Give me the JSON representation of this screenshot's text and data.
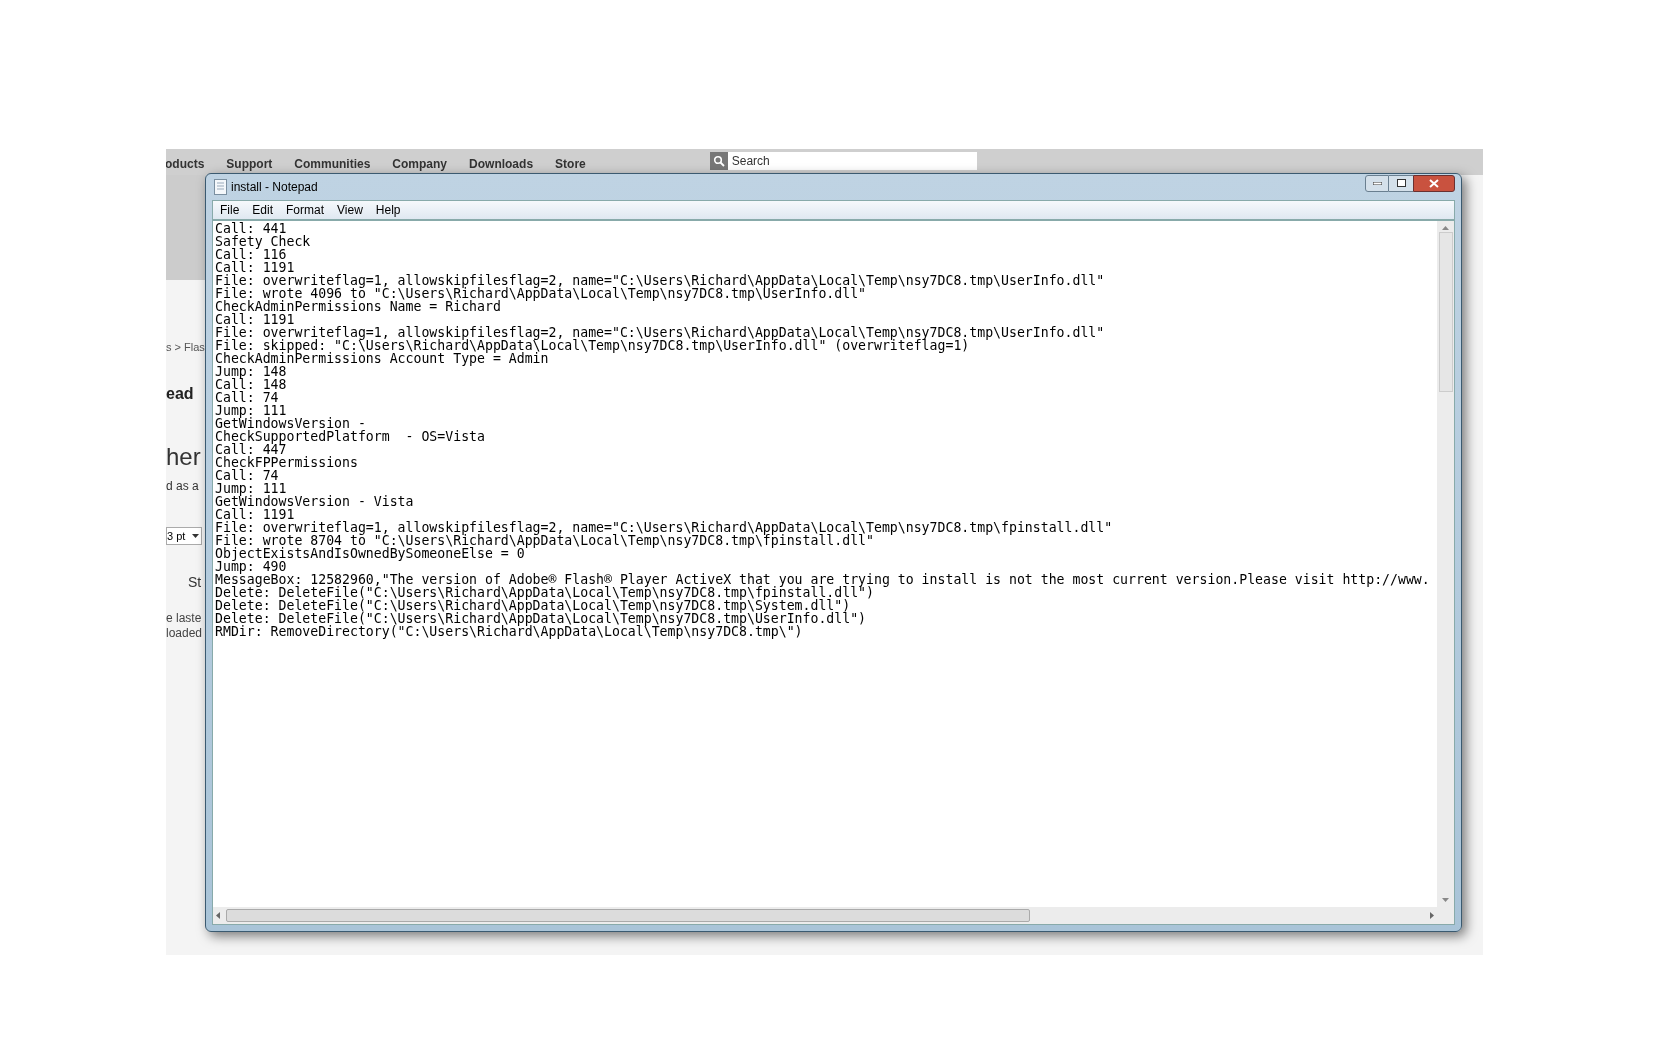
{
  "web_page": {
    "nav_items": [
      "oducts",
      "Support",
      "Communities",
      "Company",
      "Downloads",
      "Store"
    ],
    "search": {
      "placeholder": "Search"
    },
    "breadcrumb": "s > Flas",
    "heading_fragment": "ead",
    "large_heading_fragment": "her",
    "text_fragment": "d as a",
    "font_size_field": "3 pt",
    "style_fragment": "St",
    "text_lines": [
      "e laste",
      "loaded"
    ]
  },
  "notepad": {
    "title": "install - Notepad",
    "menu": [
      "File",
      "Edit",
      "Format",
      "View",
      "Help"
    ],
    "lines": [
      "Call: 441",
      "Safety Check",
      "Call: 116",
      "Call: 1191",
      "File: overwriteflag=1, allowskipfilesflag=2, name=\"C:\\Users\\Richard\\AppData\\Local\\Temp\\nsy7DC8.tmp\\UserInfo.dll\"",
      "File: wrote 4096 to \"C:\\Users\\Richard\\AppData\\Local\\Temp\\nsy7DC8.tmp\\UserInfo.dll\"",
      "CheckAdminPermissions Name = Richard",
      "Call: 1191",
      "File: overwriteflag=1, allowskipfilesflag=2, name=\"C:\\Users\\Richard\\AppData\\Local\\Temp\\nsy7DC8.tmp\\UserInfo.dll\"",
      "File: skipped: \"C:\\Users\\Richard\\AppData\\Local\\Temp\\nsy7DC8.tmp\\UserInfo.dll\" (overwriteflag=1)",
      "CheckAdminPermissions Account Type = Admin",
      "Jump: 148",
      "Call: 148",
      "Call: 74",
      "Jump: 111",
      "GetWindowsVersion -",
      "CheckSupportedPlatform  - OS=Vista",
      "Call: 447",
      "CheckFPPermissions",
      "Call: 74",
      "Jump: 111",
      "GetWindowsVersion - Vista",
      "Call: 1191",
      "File: overwriteflag=1, allowskipfilesflag=2, name=\"C:\\Users\\Richard\\AppData\\Local\\Temp\\nsy7DC8.tmp\\fpinstall.dll\"",
      "File: wrote 8704 to \"C:\\Users\\Richard\\AppData\\Local\\Temp\\nsy7DC8.tmp\\fpinstall.dll\"",
      "ObjectExistsAndIsOwnedBySomeoneElse = 0",
      "Jump: 490",
      "MessageBox: 12582960,\"The version of Adobe® Flash® Player ActiveX that you are trying to install is not the most current version.Please visit http://www.",
      "Delete: DeleteFile(\"C:\\Users\\Richard\\AppData\\Local\\Temp\\nsy7DC8.tmp\\fpinstall.dll\")",
      "Delete: DeleteFile(\"C:\\Users\\Richard\\AppData\\Local\\Temp\\nsy7DC8.tmp\\System.dll\")",
      "Delete: DeleteFile(\"C:\\Users\\Richard\\AppData\\Local\\Temp\\nsy7DC8.tmp\\UserInfo.dll\")",
      "RMDir: RemoveDirectory(\"C:\\Users\\Richard\\AppData\\Local\\Temp\\nsy7DC8.tmp\\\")"
    ]
  }
}
